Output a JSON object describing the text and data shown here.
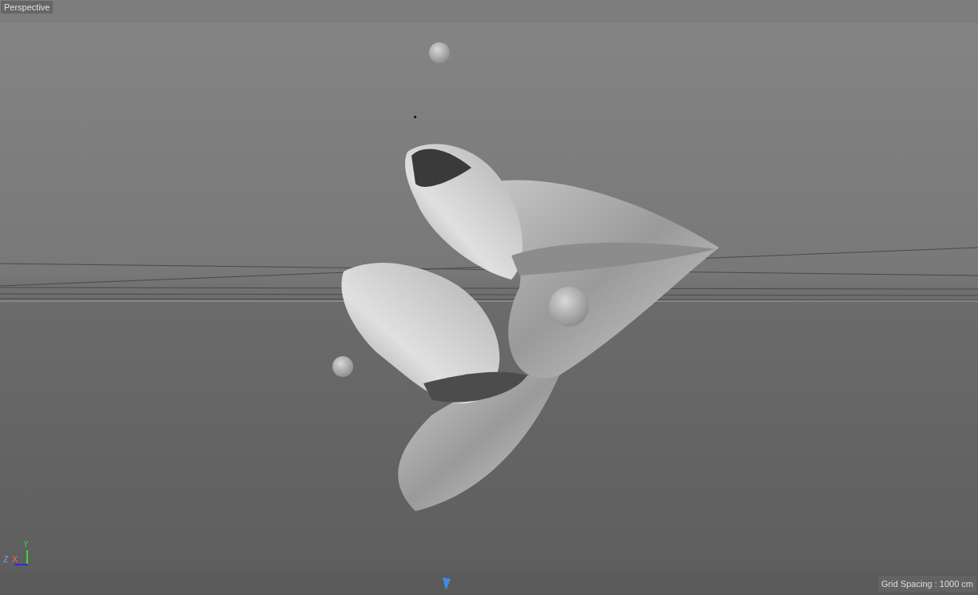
{
  "viewport": {
    "camera_label": "Perspective"
  },
  "axis_gizmo": {
    "y_label": "Y",
    "z_label": "Z",
    "x_label": "X"
  },
  "status_bar": {
    "grid_spacing": "Grid Spacing : 1000 cm"
  }
}
